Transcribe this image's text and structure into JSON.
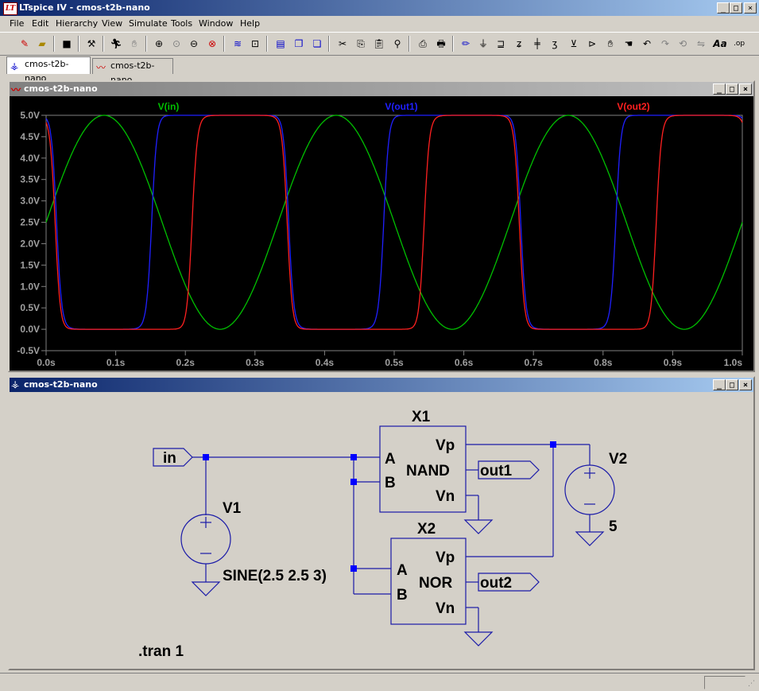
{
  "app": {
    "title": "LTspice IV - cmos-t2b-nano",
    "icon": "LT"
  },
  "window_controls": {
    "minimize": "_",
    "maximize": "□",
    "close": "×"
  },
  "menu": [
    "File",
    "Edit",
    "Hierarchy",
    "View",
    "Simulate",
    "Tools",
    "Window",
    "Help"
  ],
  "toolbar_icons": [
    "new-schematic-icon",
    "open-icon",
    "save-icon",
    "control-panel-icon",
    "run-icon",
    "halt-icon",
    "zoom-in-icon",
    "pan-icon",
    "zoom-out-icon",
    "zoom-fit-icon",
    "cancel-zoom-icon",
    "autorange-icon",
    "tile-horizontal-icon",
    "cascade-icon",
    "tile-windows-icon",
    "cut-icon",
    "copy-icon",
    "paste-icon",
    "find-icon",
    "print-setup-icon",
    "print-icon",
    "draw-wire-icon",
    "ground-icon",
    "label-icon",
    "resistor-icon",
    "capacitor-icon",
    "inductor-icon",
    "diode-icon",
    "component-icon",
    "move-icon",
    "drag-icon",
    "undo-icon",
    "redo-icon",
    "rotate-icon",
    "mirror-icon",
    "text-icon",
    "spice-directive-icon"
  ],
  "tabs": [
    {
      "label": "cmos-t2b-nano",
      "icon": "schematic-icon"
    },
    {
      "label": "cmos-t2b-nano",
      "icon": "waveform-icon"
    }
  ],
  "waveform_window": {
    "title": "cmos-t2b-nano",
    "traces": [
      {
        "name": "V(in)",
        "color": "#00c000"
      },
      {
        "name": "V(out1)",
        "color": "#2020ff"
      },
      {
        "name": "V(out2)",
        "color": "#ff2020"
      }
    ],
    "y_ticks": [
      "5.0V",
      "4.5V",
      "4.0V",
      "3.5V",
      "3.0V",
      "2.5V",
      "2.0V",
      "1.5V",
      "1.0V",
      "0.5V",
      "0.0V",
      "-0.5V"
    ],
    "x_ticks": [
      "0.0s",
      "0.1s",
      "0.2s",
      "0.3s",
      "0.4s",
      "0.5s",
      "0.6s",
      "0.7s",
      "0.8s",
      "0.9s",
      "1.0s"
    ]
  },
  "chart_data": {
    "type": "line",
    "x_range": [
      0,
      1.0
    ],
    "y_range": [
      -0.5,
      5.0
    ],
    "series": [
      {
        "name": "V(in)",
        "color": "#00c000",
        "function": "2.5 + 2.5*sin(2*pi*3*t)",
        "amplitude": 2.5,
        "offset": 2.5,
        "frequency_hz": 3
      },
      {
        "name": "V(out1)",
        "color": "#2020ff",
        "high": 5.0,
        "low": 0.0
      },
      {
        "name": "V(out2)",
        "color": "#ff2020",
        "high": 5.0,
        "low": 0.0
      }
    ]
  },
  "schematic_window": {
    "title": "cmos-t2b-nano",
    "labels": {
      "in": "in",
      "out1": "out1",
      "out2": "out2",
      "x1": "X1",
      "x2": "X2",
      "nand": "NAND",
      "nor": "NOR",
      "a": "A",
      "b": "B",
      "vp": "Vp",
      "vn": "Vn",
      "v1": "V1",
      "v2": "V2",
      "v1_value": "SINE(2.5 2.5 3)",
      "v2_value": "5",
      "directive": ".tran 1"
    }
  },
  "colors": {
    "titlebar_active": "#0a246a",
    "plot_background": "#000000",
    "schematic_wire": "#1a1aa8",
    "schematic_junction": "#0000ff",
    "schematic_background": "#d4d0c8"
  }
}
